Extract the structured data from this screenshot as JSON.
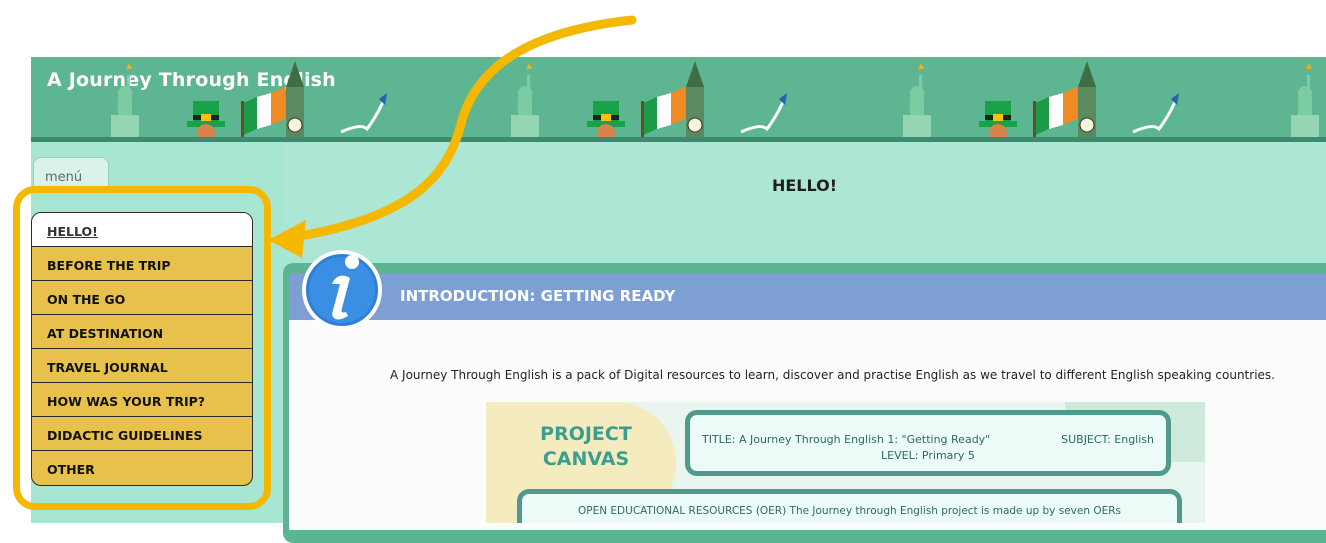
{
  "header": {
    "title": "A Journey Through English"
  },
  "menu_tab": {
    "label": "menú"
  },
  "page": {
    "heading": "HELLO!"
  },
  "menu": {
    "items": [
      {
        "label": "HELLO!",
        "active": true
      },
      {
        "label": "BEFORE THE TRIP"
      },
      {
        "label": "ON THE GO"
      },
      {
        "label": "AT DESTINATION"
      },
      {
        "label": "TRAVEL JOURNAL"
      },
      {
        "label": "HOW WAS YOUR TRIP?"
      },
      {
        "label": "DIDACTIC GUIDELINES"
      },
      {
        "label": "OTHER"
      }
    ]
  },
  "section": {
    "title": "INTRODUCTION: GETTING READY",
    "intro": "A Journey Through English is a pack of Digital resources to learn, discover and practise English as we travel to different English speaking countries."
  },
  "canvas": {
    "heading_line1": "PROJECT",
    "heading_line2": "CANVAS",
    "title": "TITLE: A Journey Through English 1: \"Getting Ready\"",
    "subject": "SUBJECT: English",
    "level": "LEVEL: Primary 5",
    "oer": "OPEN EDUCATIONAL RESOURCES (OER) The Journey through English project is made up by seven OERs"
  },
  "colors": {
    "banner": "#5db591",
    "menu_bg": "#e8c14c",
    "highlight": "#f5b800",
    "section_header": "#7e9fd4"
  }
}
